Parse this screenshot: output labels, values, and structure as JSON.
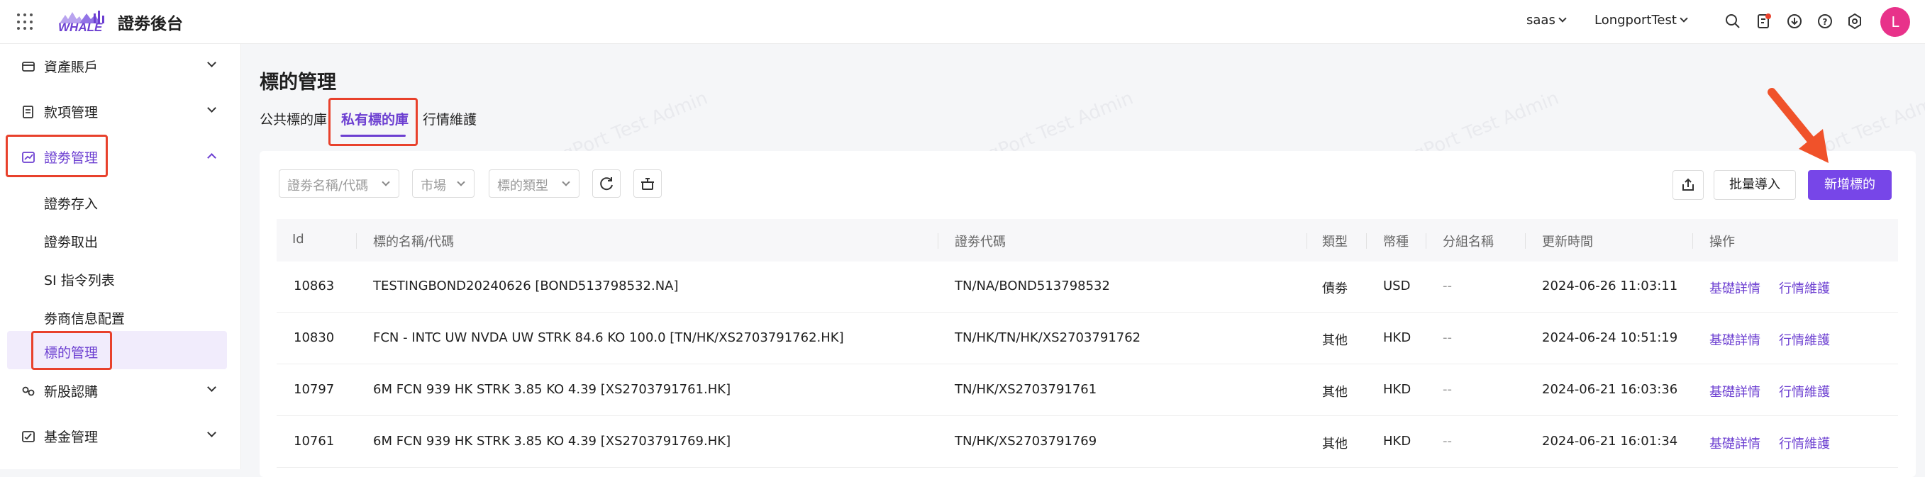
{
  "topbar": {
    "logo_text": "WHALE",
    "app_title": "證劵後台",
    "tenant": "saas",
    "org": "LongportTest",
    "avatar_letter": "L",
    "icons": [
      "search-icon",
      "notification-doc-icon",
      "download-icon",
      "help-icon",
      "settings-icon"
    ]
  },
  "sidebar": {
    "groups": [
      {
        "label": "資產賬戶",
        "icon": "wallet-icon"
      },
      {
        "label": "款項管理",
        "icon": "document-icon"
      },
      {
        "label": "證劵管理",
        "icon": "chart-icon",
        "expanded": true
      },
      {
        "label": "新股認購",
        "icon": "link-icon"
      },
      {
        "label": "基金管理",
        "icon": "fund-icon"
      }
    ],
    "sub_items": [
      "證劵存入",
      "證劵取出",
      "SI 指令列表",
      "劵商信息配置",
      "標的管理"
    ],
    "active_sub": "標的管理"
  },
  "main": {
    "title": "標的管理",
    "tabs": [
      "公共標的庫",
      "私有標的庫",
      "行情維護"
    ],
    "active_tab": "私有標的庫",
    "watermark": "LongPort Test Admin",
    "filters": {
      "security_placeholder": "證劵名稱/代碼",
      "market_placeholder": "市場",
      "type_placeholder": "標的類型"
    },
    "buttons": {
      "import": "批量導入",
      "add": "新增標的"
    },
    "table": {
      "headers": [
        "Id",
        "標的名稱/代碼",
        "證劵代碼",
        "類型",
        "幣種",
        "分組名稱",
        "更新時間",
        "操作"
      ],
      "action_labels": [
        "基礎詳情",
        "行情維護"
      ],
      "rows": [
        {
          "id": "10863",
          "name": "TESTINGBOND20240626 [BOND513798532.NA]",
          "code": "TN/NA/BOND513798532",
          "type": "債劵",
          "currency": "USD",
          "group": "--",
          "updated": "2024-06-26 11:03:11"
        },
        {
          "id": "10830",
          "name": "FCN - INTC UW NVDA UW STRK 84.6 KO 100.0 [TN/HK/XS2703791762.HK]",
          "code": "TN/HK/TN/HK/XS2703791762",
          "type": "其他",
          "currency": "HKD",
          "group": "--",
          "updated": "2024-06-24 10:51:19"
        },
        {
          "id": "10797",
          "name": "6M FCN 939 HK STRK 3.85 KO 4.39 [XS2703791761.HK]",
          "code": "TN/HK/XS2703791761",
          "type": "其他",
          "currency": "HKD",
          "group": "--",
          "updated": "2024-06-21 16:03:36"
        },
        {
          "id": "10761",
          "name": "6M FCN 939 HK STRK 3.85 KO 4.39 [XS2703791769.HK]",
          "code": "TN/HK/XS2703791769",
          "type": "其他",
          "currency": "HKD",
          "group": "--",
          "updated": "2024-06-21 16:01:34"
        }
      ]
    }
  },
  "colors": {
    "accent": "#7746e8",
    "highlight_box": "#e8412c",
    "avatar": "#e8328a"
  }
}
